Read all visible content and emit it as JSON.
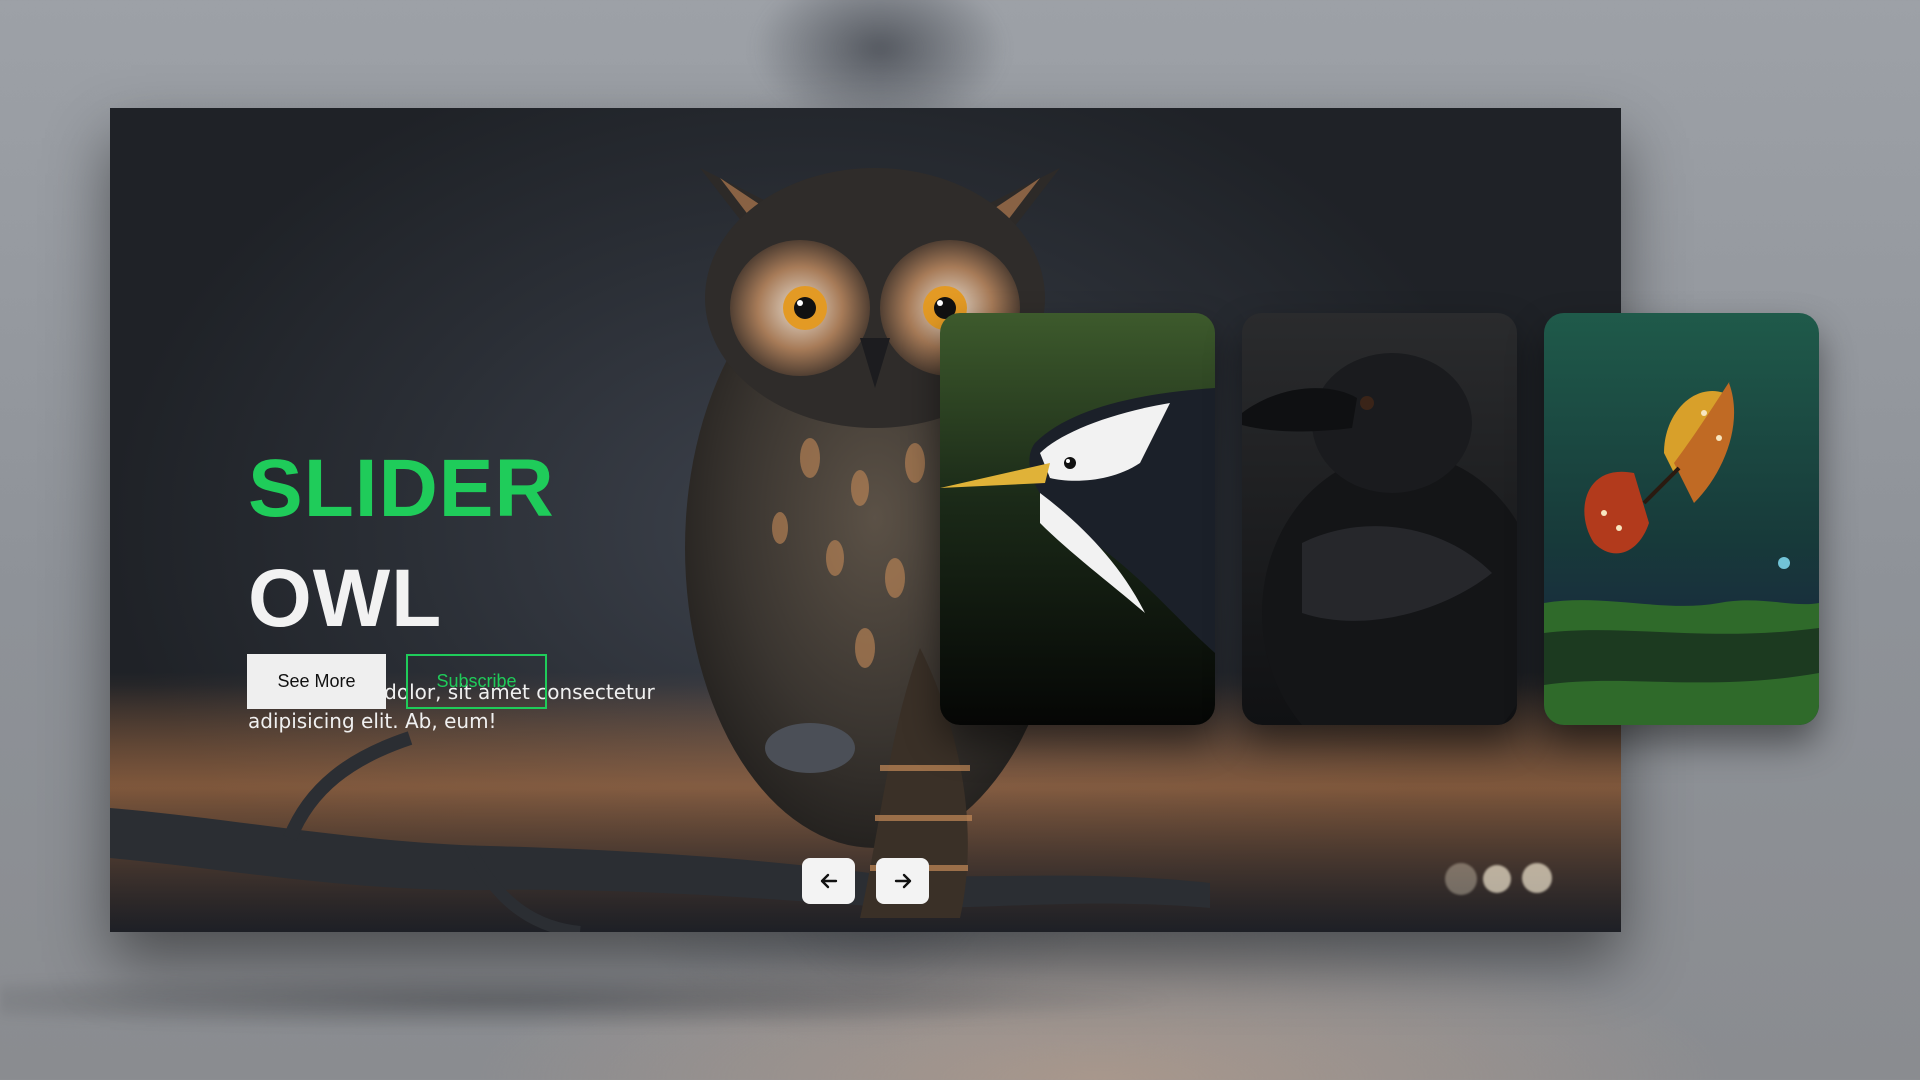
{
  "slider": {
    "title": "SLIDER",
    "subtitle": "OWL",
    "description": "Lorem ipsum dolor, sit amet consectetur adipisicing elit. Ab, eum!",
    "see_more_label": "See More",
    "subscribe_label": "Subscribe"
  },
  "navigation": {
    "prev_icon": "arrow-left-icon",
    "next_icon": "arrow-right-icon"
  },
  "thumbnails": [
    {
      "subject": "kingfisher"
    },
    {
      "subject": "crow"
    },
    {
      "subject": "butterfly"
    }
  ],
  "colors": {
    "accent": "#1fcc5a",
    "title_white": "#f2f2f2",
    "button_light": "#efefef"
  }
}
